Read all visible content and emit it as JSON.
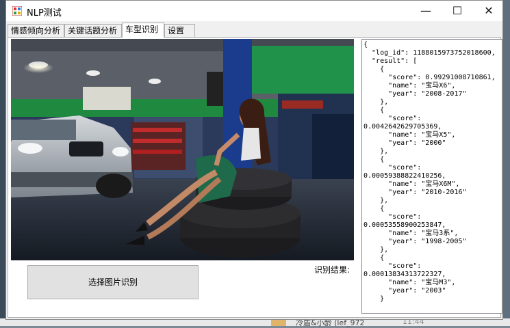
{
  "window": {
    "title": "NLP测试",
    "minimize_glyph": "—",
    "maximize_glyph": "☐",
    "close_glyph": "✕"
  },
  "tabs": [
    {
      "label": "情感倾向分析"
    },
    {
      "label": "关键话题分析"
    },
    {
      "label": "车型识别"
    },
    {
      "label": "设置"
    }
  ],
  "active_tab": "车型识别",
  "main": {
    "select_button_label": "选择图片识别",
    "result_label": "识别结果:",
    "result_text": "{\n  \"log_id\": 1188015973752018600,\n  \"result\": [\n    {\n      \"score\": 0.99291008710861,\n      \"name\": \"宝马X6\",\n      \"year\": \"2008-2017\"\n    },\n    {\n      \"score\":\n0.0042642629705369,\n      \"name\": \"宝马X5\",\n      \"year\": \"2000\"\n    },\n    {\n      \"score\":\n0.00059388822410256,\n      \"name\": \"宝马X6M\",\n      \"year\": \"2010-2016\"\n    },\n    {\n      \"score\":\n0.00053558900253847,\n      \"name\": \"宝马3系\",\n      \"year\": \"1998-2005\"\n    },\n    {\n      \"score\":\n0.00013834313722327,\n      \"name\": \"宝马M3\",\n      \"year\": \"2003\"\n    }"
  },
  "taskbar": {
    "text": "冷盾&小龄 (lef_972",
    "time": "11:44"
  },
  "colors": {
    "garage_green": "#1f8a3f",
    "tire_dark": "#1c1c1e",
    "floor_blue": "#2d4a6a"
  }
}
